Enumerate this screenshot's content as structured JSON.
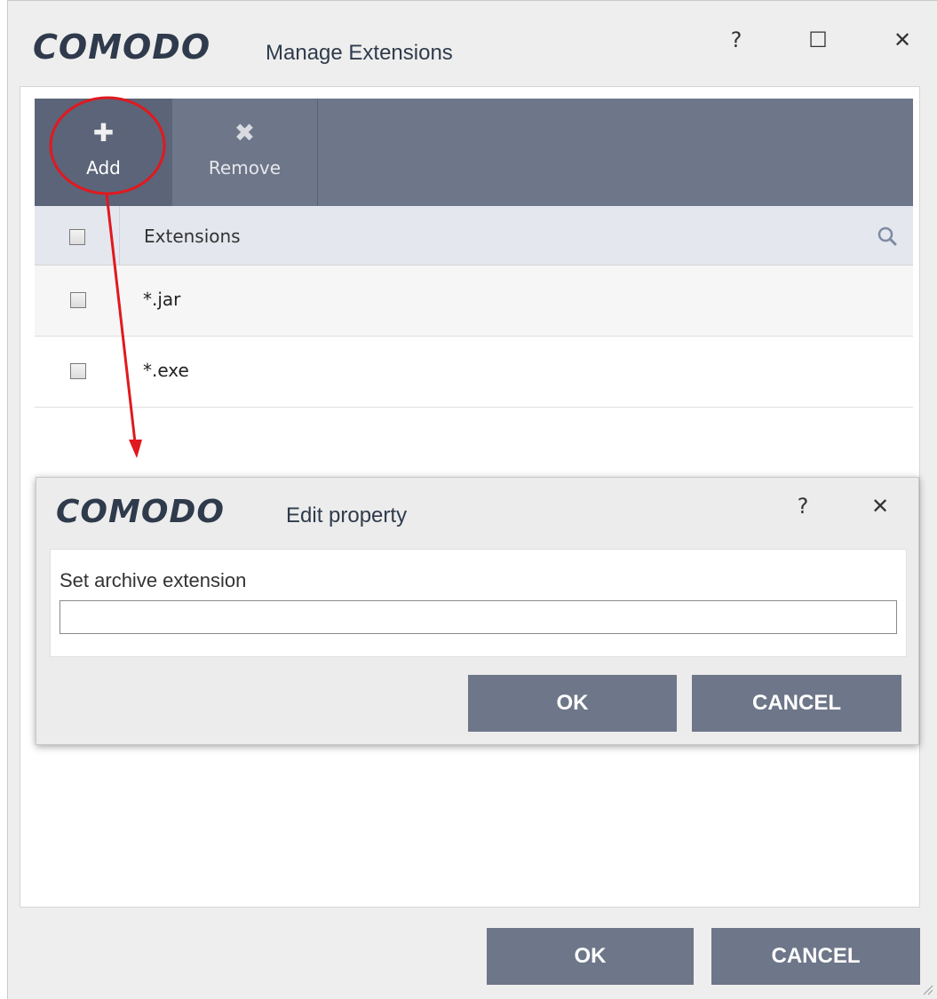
{
  "main_window": {
    "logo": "COMODO",
    "title": "Manage Extensions",
    "help_label": "?",
    "maximize_label": "☐",
    "close_label": "✕",
    "toolbar": {
      "add_icon": "✚",
      "add_label": "Add",
      "remove_icon": "✖",
      "remove_label": "Remove"
    },
    "table": {
      "column_header": "Extensions",
      "rows": [
        {
          "extension": "*.jar"
        },
        {
          "extension": "*.exe"
        }
      ]
    },
    "ok_label": "OK",
    "cancel_label": "CANCEL"
  },
  "edit_dialog": {
    "logo": "COMODO",
    "title": "Edit property",
    "help_label": "?",
    "close_label": "✕",
    "field_label": "Set archive extension",
    "field_value": "",
    "ok_label": "OK",
    "cancel_label": "CANCEL"
  },
  "colors": {
    "toolbar_bg": "#6e7689",
    "toolbar_active_bg": "#5b6478",
    "header_bg": "#e4e7ee",
    "button_bg": "#6e7689",
    "annotation_red": "#e0191f",
    "logo_color": "#2f3b4c"
  }
}
